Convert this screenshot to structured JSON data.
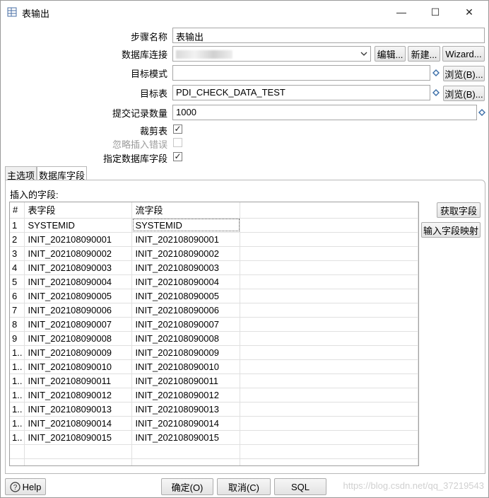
{
  "window": {
    "title": "表输出",
    "controls": {
      "minimize": "—",
      "maximize": "☐",
      "close": "✕"
    }
  },
  "form": {
    "step_name_label": "步骤名称",
    "step_name_value": "表输出",
    "connection_label": "数据库连接",
    "connection_value": "",
    "edit_button": "编辑...",
    "new_button": "新建...",
    "wizard_button": "Wizard...",
    "target_schema_label": "目标模式",
    "target_schema_value": "",
    "browse_button": "浏览(B)...",
    "target_table_label": "目标表",
    "target_table_value": "PDI_CHECK_DATA_TEST",
    "commit_size_label": "提交记录数量",
    "commit_size_value": "1000",
    "truncate_label": "裁剪表",
    "truncate_checked": "✓",
    "ignore_errors_label": "忽略插入错误",
    "specify_fields_label": "指定数据库字段",
    "specify_fields_checked": "✓"
  },
  "tabs": [
    "主选项",
    "数据库字段"
  ],
  "fields_section": {
    "label": "插入的字段:",
    "columns": [
      "#",
      "表字段",
      "流字段"
    ],
    "rows": [
      {
        "n": "1",
        "table": "SYSTEMID",
        "stream": "SYSTEMID"
      },
      {
        "n": "2",
        "table": "INIT_202108090001",
        "stream": "INIT_202108090001"
      },
      {
        "n": "3",
        "table": "INIT_202108090002",
        "stream": "INIT_202108090002"
      },
      {
        "n": "4",
        "table": "INIT_202108090003",
        "stream": "INIT_202108090003"
      },
      {
        "n": "5",
        "table": "INIT_202108090004",
        "stream": "INIT_202108090004"
      },
      {
        "n": "6",
        "table": "INIT_202108090005",
        "stream": "INIT_202108090005"
      },
      {
        "n": "7",
        "table": "INIT_202108090006",
        "stream": "INIT_202108090006"
      },
      {
        "n": "8",
        "table": "INIT_202108090007",
        "stream": "INIT_202108090007"
      },
      {
        "n": "9",
        "table": "INIT_202108090008",
        "stream": "INIT_202108090008"
      },
      {
        "n": "1..",
        "table": "INIT_202108090009",
        "stream": "INIT_202108090009"
      },
      {
        "n": "1..",
        "table": "INIT_202108090010",
        "stream": "INIT_202108090010"
      },
      {
        "n": "1..",
        "table": "INIT_202108090011",
        "stream": "INIT_202108090011"
      },
      {
        "n": "1..",
        "table": "INIT_202108090012",
        "stream": "INIT_202108090012"
      },
      {
        "n": "1..",
        "table": "INIT_202108090013",
        "stream": "INIT_202108090013"
      },
      {
        "n": "1..",
        "table": "INIT_202108090014",
        "stream": "INIT_202108090014"
      },
      {
        "n": "1..",
        "table": "INIT_202108090015",
        "stream": "INIT_202108090015"
      }
    ],
    "get_fields_button": "获取字段",
    "map_fields_button": "输入字段映射"
  },
  "footer": {
    "help_button": "Help",
    "ok_button": "确定(O)",
    "cancel_button": "取消(C)",
    "sql_button": "SQL",
    "watermark": "https://blog.csdn.net/qq_37219543"
  }
}
